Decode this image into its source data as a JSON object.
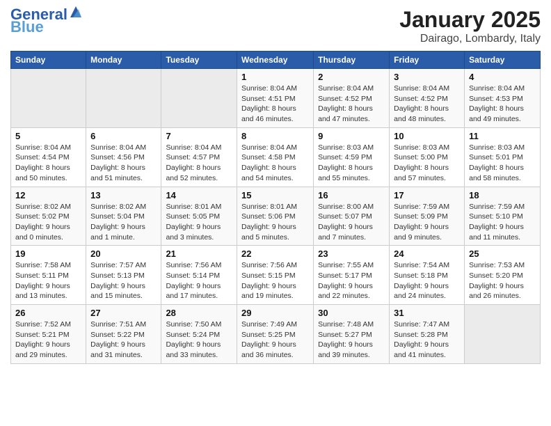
{
  "header": {
    "logo_line1": "General",
    "logo_line2": "Blue",
    "title": "January 2025",
    "subtitle": "Dairago, Lombardy, Italy"
  },
  "weekdays": [
    "Sunday",
    "Monday",
    "Tuesday",
    "Wednesday",
    "Thursday",
    "Friday",
    "Saturday"
  ],
  "weeks": [
    [
      {
        "day": "",
        "info": ""
      },
      {
        "day": "",
        "info": ""
      },
      {
        "day": "",
        "info": ""
      },
      {
        "day": "1",
        "info": "Sunrise: 8:04 AM\nSunset: 4:51 PM\nDaylight: 8 hours\nand 46 minutes."
      },
      {
        "day": "2",
        "info": "Sunrise: 8:04 AM\nSunset: 4:52 PM\nDaylight: 8 hours\nand 47 minutes."
      },
      {
        "day": "3",
        "info": "Sunrise: 8:04 AM\nSunset: 4:52 PM\nDaylight: 8 hours\nand 48 minutes."
      },
      {
        "day": "4",
        "info": "Sunrise: 8:04 AM\nSunset: 4:53 PM\nDaylight: 8 hours\nand 49 minutes."
      }
    ],
    [
      {
        "day": "5",
        "info": "Sunrise: 8:04 AM\nSunset: 4:54 PM\nDaylight: 8 hours\nand 50 minutes."
      },
      {
        "day": "6",
        "info": "Sunrise: 8:04 AM\nSunset: 4:56 PM\nDaylight: 8 hours\nand 51 minutes."
      },
      {
        "day": "7",
        "info": "Sunrise: 8:04 AM\nSunset: 4:57 PM\nDaylight: 8 hours\nand 52 minutes."
      },
      {
        "day": "8",
        "info": "Sunrise: 8:04 AM\nSunset: 4:58 PM\nDaylight: 8 hours\nand 54 minutes."
      },
      {
        "day": "9",
        "info": "Sunrise: 8:03 AM\nSunset: 4:59 PM\nDaylight: 8 hours\nand 55 minutes."
      },
      {
        "day": "10",
        "info": "Sunrise: 8:03 AM\nSunset: 5:00 PM\nDaylight: 8 hours\nand 57 minutes."
      },
      {
        "day": "11",
        "info": "Sunrise: 8:03 AM\nSunset: 5:01 PM\nDaylight: 8 hours\nand 58 minutes."
      }
    ],
    [
      {
        "day": "12",
        "info": "Sunrise: 8:02 AM\nSunset: 5:02 PM\nDaylight: 9 hours\nand 0 minutes."
      },
      {
        "day": "13",
        "info": "Sunrise: 8:02 AM\nSunset: 5:04 PM\nDaylight: 9 hours\nand 1 minute."
      },
      {
        "day": "14",
        "info": "Sunrise: 8:01 AM\nSunset: 5:05 PM\nDaylight: 9 hours\nand 3 minutes."
      },
      {
        "day": "15",
        "info": "Sunrise: 8:01 AM\nSunset: 5:06 PM\nDaylight: 9 hours\nand 5 minutes."
      },
      {
        "day": "16",
        "info": "Sunrise: 8:00 AM\nSunset: 5:07 PM\nDaylight: 9 hours\nand 7 minutes."
      },
      {
        "day": "17",
        "info": "Sunrise: 7:59 AM\nSunset: 5:09 PM\nDaylight: 9 hours\nand 9 minutes."
      },
      {
        "day": "18",
        "info": "Sunrise: 7:59 AM\nSunset: 5:10 PM\nDaylight: 9 hours\nand 11 minutes."
      }
    ],
    [
      {
        "day": "19",
        "info": "Sunrise: 7:58 AM\nSunset: 5:11 PM\nDaylight: 9 hours\nand 13 minutes."
      },
      {
        "day": "20",
        "info": "Sunrise: 7:57 AM\nSunset: 5:13 PM\nDaylight: 9 hours\nand 15 minutes."
      },
      {
        "day": "21",
        "info": "Sunrise: 7:56 AM\nSunset: 5:14 PM\nDaylight: 9 hours\nand 17 minutes."
      },
      {
        "day": "22",
        "info": "Sunrise: 7:56 AM\nSunset: 5:15 PM\nDaylight: 9 hours\nand 19 minutes."
      },
      {
        "day": "23",
        "info": "Sunrise: 7:55 AM\nSunset: 5:17 PM\nDaylight: 9 hours\nand 22 minutes."
      },
      {
        "day": "24",
        "info": "Sunrise: 7:54 AM\nSunset: 5:18 PM\nDaylight: 9 hours\nand 24 minutes."
      },
      {
        "day": "25",
        "info": "Sunrise: 7:53 AM\nSunset: 5:20 PM\nDaylight: 9 hours\nand 26 minutes."
      }
    ],
    [
      {
        "day": "26",
        "info": "Sunrise: 7:52 AM\nSunset: 5:21 PM\nDaylight: 9 hours\nand 29 minutes."
      },
      {
        "day": "27",
        "info": "Sunrise: 7:51 AM\nSunset: 5:22 PM\nDaylight: 9 hours\nand 31 minutes."
      },
      {
        "day": "28",
        "info": "Sunrise: 7:50 AM\nSunset: 5:24 PM\nDaylight: 9 hours\nand 33 minutes."
      },
      {
        "day": "29",
        "info": "Sunrise: 7:49 AM\nSunset: 5:25 PM\nDaylight: 9 hours\nand 36 minutes."
      },
      {
        "day": "30",
        "info": "Sunrise: 7:48 AM\nSunset: 5:27 PM\nDaylight: 9 hours\nand 39 minutes."
      },
      {
        "day": "31",
        "info": "Sunrise: 7:47 AM\nSunset: 5:28 PM\nDaylight: 9 hours\nand 41 minutes."
      },
      {
        "day": "",
        "info": ""
      }
    ]
  ]
}
